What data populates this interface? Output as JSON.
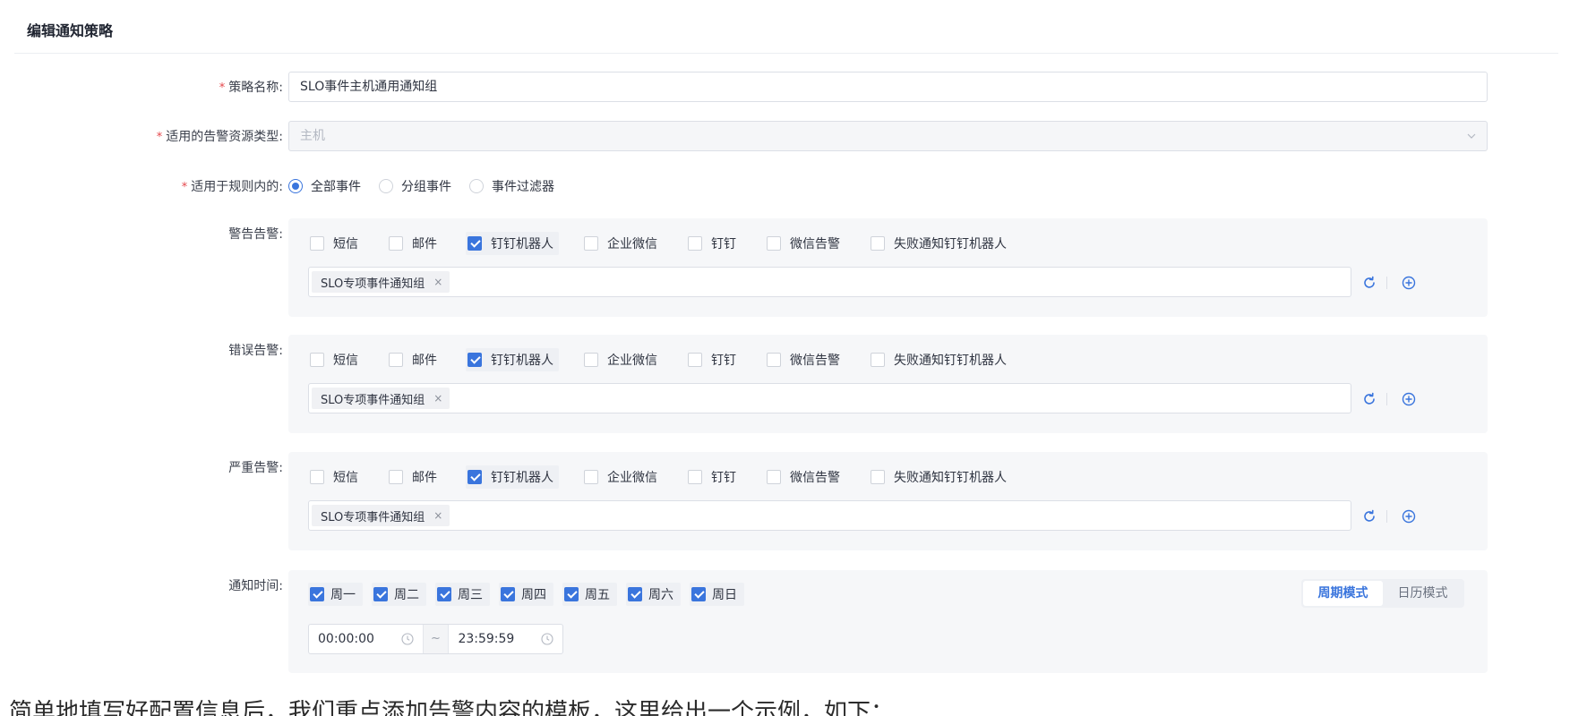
{
  "header": {
    "title": "编辑通知策略"
  },
  "form": {
    "policy_name": {
      "required_mark": "*",
      "label": "策略名称:",
      "value": "SLO事件主机通用通知组"
    },
    "resource_type": {
      "required_mark": "*",
      "label": "适用的告警资源类型:",
      "value": "主机"
    },
    "scope": {
      "required_mark": "*",
      "label": "适用于规则内的:",
      "options": [
        {
          "label": "全部事件",
          "selected": true
        },
        {
          "label": "分组事件",
          "selected": false
        },
        {
          "label": "事件过滤器",
          "selected": false
        }
      ]
    },
    "alerts": [
      {
        "label": "警告告警:",
        "channels": [
          {
            "label": "短信",
            "checked": false
          },
          {
            "label": "邮件",
            "checked": false
          },
          {
            "label": "钉钉机器人",
            "checked": true
          },
          {
            "label": "企业微信",
            "checked": false
          },
          {
            "label": "钉钉",
            "checked": false
          },
          {
            "label": "微信告警",
            "checked": false
          },
          {
            "label": "失败通知钉钉机器人",
            "checked": false
          }
        ],
        "tags": [
          "SLO专项事件通知组"
        ]
      },
      {
        "label": "错误告警:",
        "channels": [
          {
            "label": "短信",
            "checked": false
          },
          {
            "label": "邮件",
            "checked": false
          },
          {
            "label": "钉钉机器人",
            "checked": true
          },
          {
            "label": "企业微信",
            "checked": false
          },
          {
            "label": "钉钉",
            "checked": false
          },
          {
            "label": "微信告警",
            "checked": false
          },
          {
            "label": "失败通知钉钉机器人",
            "checked": false
          }
        ],
        "tags": [
          "SLO专项事件通知组"
        ]
      },
      {
        "label": "严重告警:",
        "channels": [
          {
            "label": "短信",
            "checked": false
          },
          {
            "label": "邮件",
            "checked": false
          },
          {
            "label": "钉钉机器人",
            "checked": true
          },
          {
            "label": "企业微信",
            "checked": false
          },
          {
            "label": "钉钉",
            "checked": false
          },
          {
            "label": "微信告警",
            "checked": false
          },
          {
            "label": "失败通知钉钉机器人",
            "checked": false
          }
        ],
        "tags": [
          "SLO专项事件通知组"
        ]
      }
    ],
    "notify_time": {
      "label": "通知时间:",
      "days": [
        {
          "label": "周一",
          "checked": true
        },
        {
          "label": "周二",
          "checked": true
        },
        {
          "label": "周三",
          "checked": true
        },
        {
          "label": "周四",
          "checked": true
        },
        {
          "label": "周五",
          "checked": true
        },
        {
          "label": "周六",
          "checked": true
        },
        {
          "label": "周日",
          "checked": true
        }
      ],
      "modes": [
        {
          "label": "周期模式",
          "active": true
        },
        {
          "label": "日历模式",
          "active": false
        }
      ],
      "start_time": "00:00:00",
      "separator": "~",
      "end_time": "23:59:59"
    }
  },
  "tag_close_glyph": "×",
  "icons": {
    "refresh": "refresh-icon",
    "add": "add-circle-icon",
    "clock": "clock-icon",
    "caret": "chevron-down-icon"
  },
  "colors": {
    "primary": "#3a75dd",
    "required": "#e5484d",
    "panel_bg": "#f6f7f9"
  },
  "caption": "简单地填写好配置信息后，我们重点添加告警内容的模板，这里给出一个示例，如下："
}
